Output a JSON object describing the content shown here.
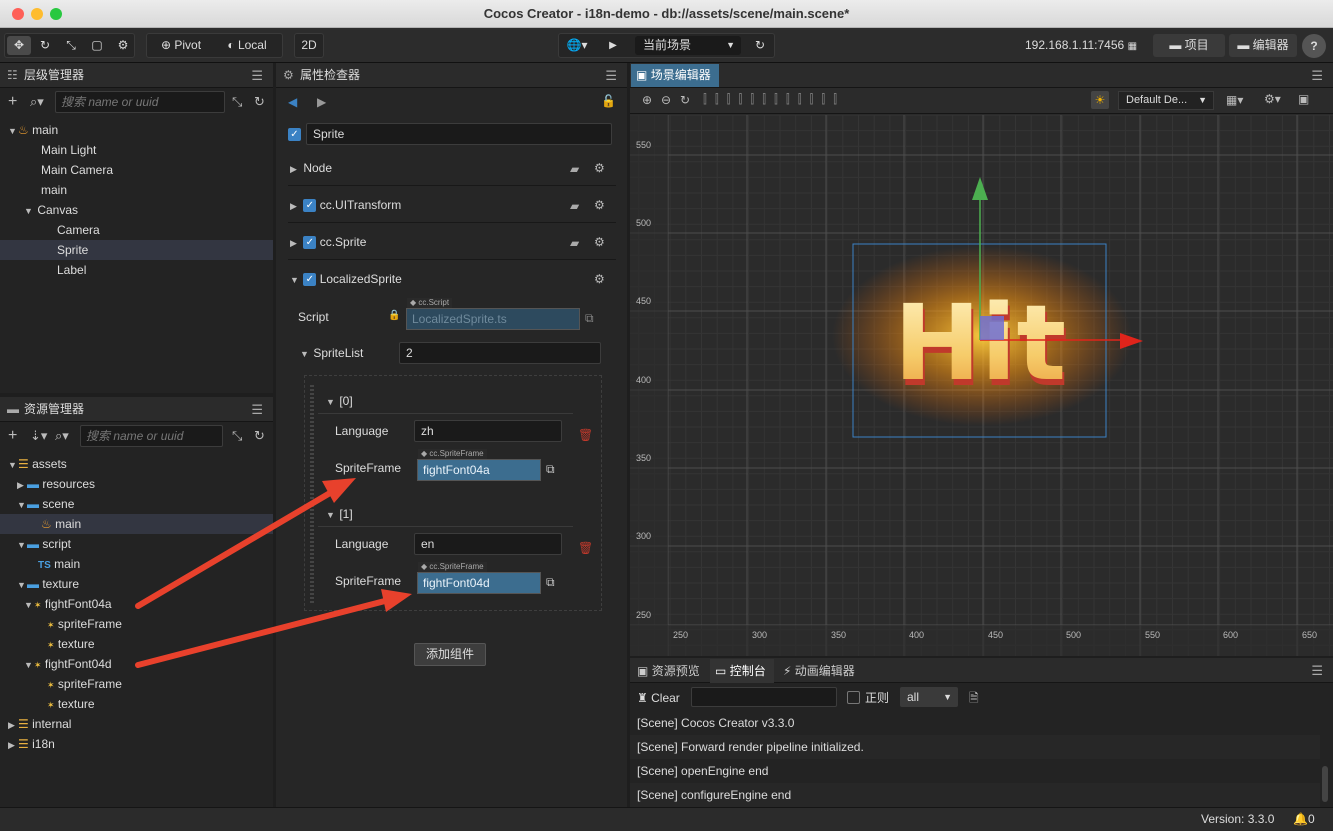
{
  "window": {
    "title": "Cocos Creator - i18n-demo - db://assets/scene/main.scene*"
  },
  "toolbar": {
    "pivot": "Pivot",
    "local": "Local",
    "mode2d": "2D",
    "scene_select": "当前场景",
    "ip": "192.168.1.11:7456",
    "project_btn": "项目",
    "editor_btn": "编辑器",
    "help": "?"
  },
  "hierarchy": {
    "title": "层级管理器",
    "search_placeholder": "搜索 name or uuid",
    "nodes": [
      "main",
      "Main Light",
      "Main Camera",
      "main",
      "Canvas",
      "Camera",
      "Sprite",
      "Label"
    ]
  },
  "inspector": {
    "title": "属性检查器",
    "node_name": "Sprite",
    "sections": [
      "Node",
      "cc.UITransform",
      "cc.Sprite",
      "LocalizedSprite"
    ],
    "script_label": "Script",
    "script_tag": "cc.Script",
    "script_value": "LocalizedSprite.ts",
    "spritelist_label": "SpriteList",
    "spritelist_count": "2",
    "items": [
      {
        "index": "[0]",
        "language_label": "Language",
        "language": "zh",
        "spriteframe_label": "SpriteFrame",
        "sf_tag": "cc.SpriteFrame",
        "spriteframe": "fightFont04a"
      },
      {
        "index": "[1]",
        "language_label": "Language",
        "language": "en",
        "spriteframe_label": "SpriteFrame",
        "sf_tag": "cc.SpriteFrame",
        "spriteframe": "fightFont04d"
      }
    ],
    "add_component": "添加组件"
  },
  "assets": {
    "title": "资源管理器",
    "search_placeholder": "搜索 name or uuid",
    "items": [
      "assets",
      "resources",
      "scene",
      "main",
      "script",
      "main",
      "texture",
      "fightFont04a",
      "spriteFrame",
      "texture",
      "fightFont04d",
      "spriteFrame",
      "texture",
      "internal",
      "i18n"
    ],
    "ts_badge": "TS"
  },
  "scene": {
    "title": "场景编辑器",
    "layout_select": "Default De...",
    "hit_text": "Hit",
    "y_labels": [
      "550",
      "500",
      "450",
      "400",
      "350",
      "300",
      "250"
    ],
    "x_labels": [
      "250",
      "300",
      "350",
      "400",
      "450",
      "500",
      "550",
      "600",
      "650"
    ]
  },
  "bottom": {
    "tabs": [
      "资源预览",
      "控制台",
      "动画编辑器"
    ],
    "clear": "Clear",
    "regex": "正则",
    "level": "all",
    "logs": [
      "[Scene] Cocos Creator v3.3.0",
      "[Scene] Forward render pipeline initialized.",
      "[Scene] openEngine end",
      "[Scene] configureEngine end"
    ]
  },
  "status": {
    "version": "Version: 3.3.0",
    "notifications": "0"
  },
  "colors": {
    "accent": "#3b82c4",
    "arrow": "#e8412c",
    "gizmo_x": "#e0241b",
    "gizmo_y": "#4caf50"
  }
}
